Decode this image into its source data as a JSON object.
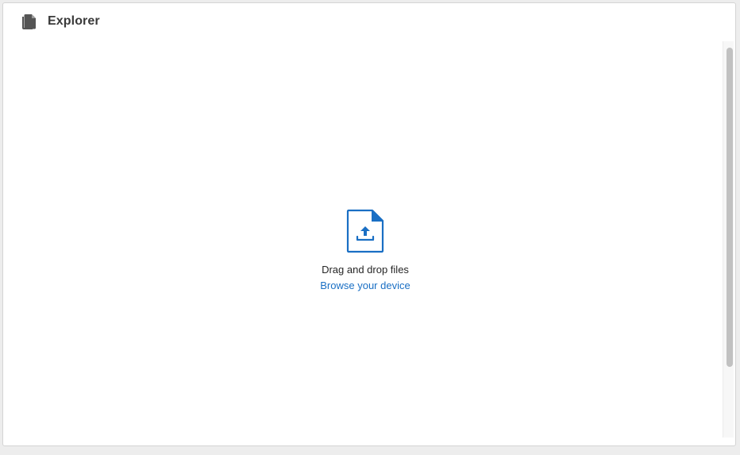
{
  "header": {
    "title": "Explorer",
    "icon": "documents-icon"
  },
  "drop_zone": {
    "icon": "file-upload-icon",
    "instruction": "Drag and drop files",
    "browse_label": "Browse your device"
  },
  "colors": {
    "accent": "#1a6fc4",
    "title": "#3a3a3a",
    "icon_gray": "#555555"
  }
}
